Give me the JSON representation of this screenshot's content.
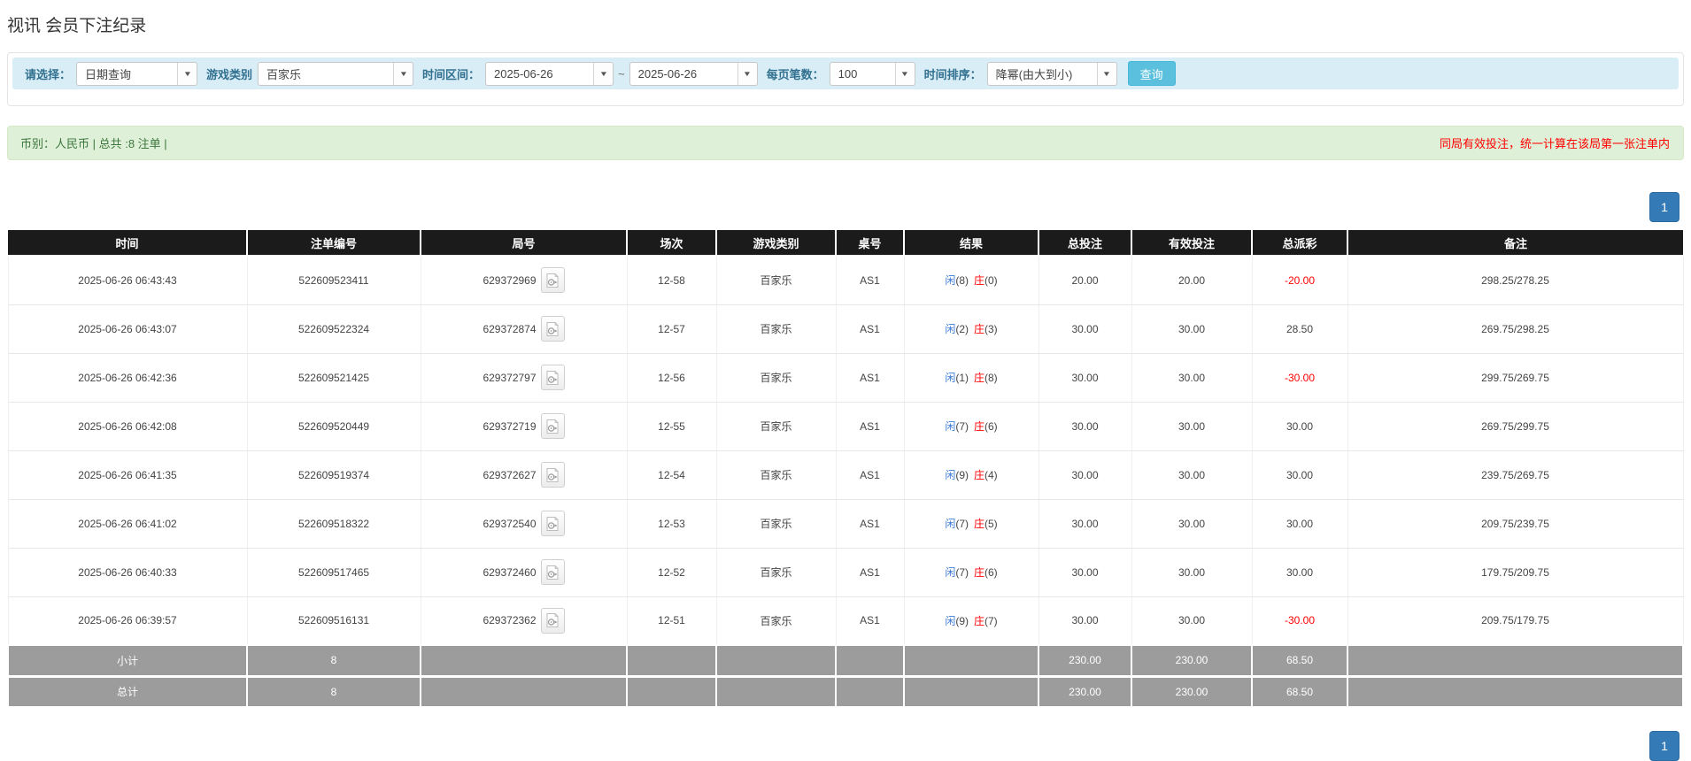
{
  "page": {
    "title": "视讯 会员下注纪录"
  },
  "colors": {
    "accent_blue": "#337ab7",
    "info_button": "#5bc0de",
    "filter_bg": "#d9edf7",
    "filter_label": "#31708f",
    "success_bg": "#dff0d8",
    "success_text": "#3c763d",
    "red": "#ff0000",
    "link_blue": "#3a7bd5",
    "table_header_bg": "#1b1b1b",
    "table_footer_bg": "#9c9c9c"
  },
  "filters": {
    "select_label": "请选择：",
    "select_value": "日期查询",
    "game_type_label": "游戏类别",
    "game_type_value": "百家乐",
    "time_range_label": "时间区间：",
    "date_from": "2025-06-26",
    "range_separator": "~",
    "date_to": "2025-06-26",
    "page_size_label": "每页笔数：",
    "page_size_value": "100",
    "sort_label": "时间排序：",
    "sort_value": "降幂(由大到小)",
    "search_button": "查询"
  },
  "summary_bar": {
    "left_text": "币别：人民币 | 总共 :8 注单 |",
    "right_notice": "同局有效投注，统一计算在该局第一张注单内"
  },
  "pagination": {
    "page": "1"
  },
  "table": {
    "headers": [
      "时间",
      "注单编号",
      "局号",
      "场次",
      "游戏类别",
      "桌号",
      "结果",
      "总投注",
      "有效投注",
      "总派彩",
      "备注"
    ],
    "rows": [
      {
        "time": "2025-06-26 06:43:43",
        "bet_id": "522609523411",
        "round_id": "629372969",
        "session": "12-58",
        "game": "百家乐",
        "table": "AS1",
        "player": "闲",
        "player_score": "(8)",
        "banker": "庄",
        "banker_score": "(0)",
        "total_bet": "20.00",
        "valid_bet": "20.00",
        "payout": "-20.00",
        "note": "298.25/278.25"
      },
      {
        "time": "2025-06-26 06:43:07",
        "bet_id": "522609522324",
        "round_id": "629372874",
        "session": "12-57",
        "game": "百家乐",
        "table": "AS1",
        "player": "闲",
        "player_score": "(2)",
        "banker": "庄",
        "banker_score": "(3)",
        "total_bet": "30.00",
        "valid_bet": "30.00",
        "payout": "28.50",
        "note": "269.75/298.25"
      },
      {
        "time": "2025-06-26 06:42:36",
        "bet_id": "522609521425",
        "round_id": "629372797",
        "session": "12-56",
        "game": "百家乐",
        "table": "AS1",
        "player": "闲",
        "player_score": "(1)",
        "banker": "庄",
        "banker_score": "(8)",
        "total_bet": "30.00",
        "valid_bet": "30.00",
        "payout": "-30.00",
        "note": "299.75/269.75"
      },
      {
        "time": "2025-06-26 06:42:08",
        "bet_id": "522609520449",
        "round_id": "629372719",
        "session": "12-55",
        "game": "百家乐",
        "table": "AS1",
        "player": "闲",
        "player_score": "(7)",
        "banker": "庄",
        "banker_score": "(6)",
        "total_bet": "30.00",
        "valid_bet": "30.00",
        "payout": "30.00",
        "note": "269.75/299.75"
      },
      {
        "time": "2025-06-26 06:41:35",
        "bet_id": "522609519374",
        "round_id": "629372627",
        "session": "12-54",
        "game": "百家乐",
        "table": "AS1",
        "player": "闲",
        "player_score": "(9)",
        "banker": "庄",
        "banker_score": "(4)",
        "total_bet": "30.00",
        "valid_bet": "30.00",
        "payout": "30.00",
        "note": "239.75/269.75"
      },
      {
        "time": "2025-06-26 06:41:02",
        "bet_id": "522609518322",
        "round_id": "629372540",
        "session": "12-53",
        "game": "百家乐",
        "table": "AS1",
        "player": "闲",
        "player_score": "(7)",
        "banker": "庄",
        "banker_score": "(5)",
        "total_bet": "30.00",
        "valid_bet": "30.00",
        "payout": "30.00",
        "note": "209.75/239.75"
      },
      {
        "time": "2025-06-26 06:40:33",
        "bet_id": "522609517465",
        "round_id": "629372460",
        "session": "12-52",
        "game": "百家乐",
        "table": "AS1",
        "player": "闲",
        "player_score": "(7)",
        "banker": "庄",
        "banker_score": "(6)",
        "total_bet": "30.00",
        "valid_bet": "30.00",
        "payout": "30.00",
        "note": "179.75/209.75"
      },
      {
        "time": "2025-06-26 06:39:57",
        "bet_id": "522609516131",
        "round_id": "629372362",
        "session": "12-51",
        "game": "百家乐",
        "table": "AS1",
        "player": "闲",
        "player_score": "(9)",
        "banker": "庄",
        "banker_score": "(7)",
        "total_bet": "30.00",
        "valid_bet": "30.00",
        "payout": "-30.00",
        "note": "209.75/179.75"
      }
    ],
    "footer": [
      {
        "label": "小计",
        "count": "8",
        "total_bet": "230.00",
        "valid_bet": "230.00",
        "payout": "68.50"
      },
      {
        "label": "总计",
        "count": "8",
        "total_bet": "230.00",
        "valid_bet": "230.00",
        "payout": "68.50"
      }
    ]
  }
}
